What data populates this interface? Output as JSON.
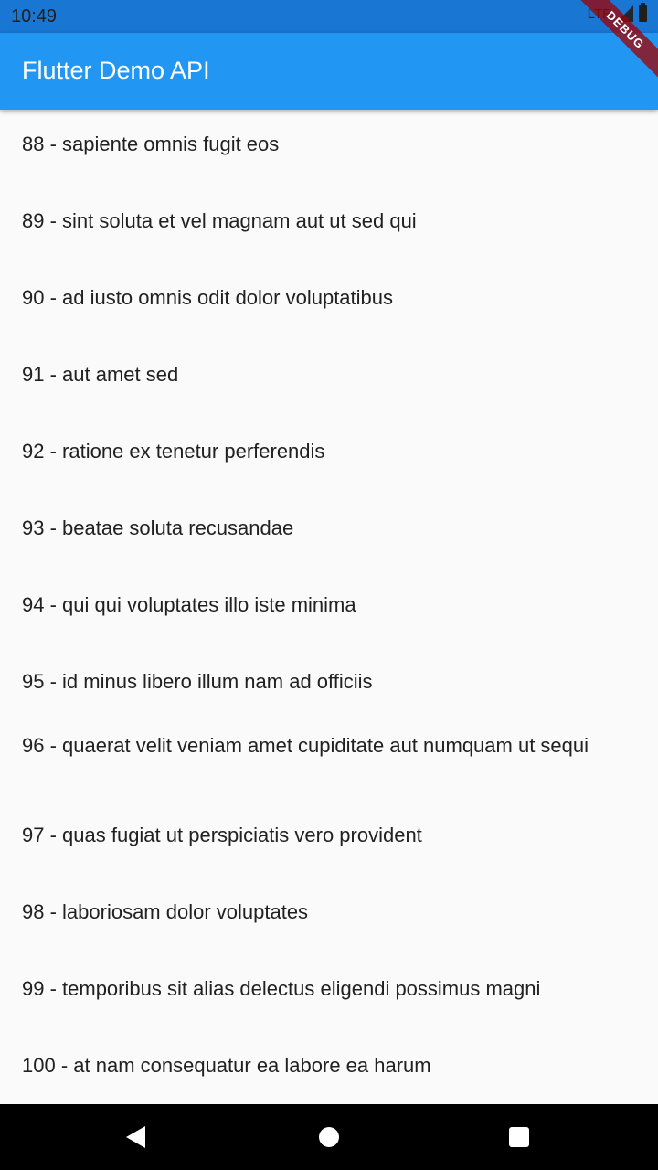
{
  "status_bar": {
    "time": "10:49",
    "network": "LTE"
  },
  "app_bar": {
    "title": "Flutter Demo API"
  },
  "debug_banner": {
    "label": "DEBUG"
  },
  "list": {
    "items": [
      "88 - sapiente omnis fugit eos",
      "89 - sint soluta et vel magnam aut ut sed qui",
      "90 - ad iusto omnis odit dolor voluptatibus",
      "91 - aut amet sed",
      "92 - ratione ex tenetur perferendis",
      "93 - beatae soluta recusandae",
      "94 - qui qui voluptates illo iste minima",
      "95 - id minus libero illum nam ad officiis",
      "96 - quaerat velit veniam amet cupiditate aut numquam ut sequi",
      "97 - quas fugiat ut perspiciatis vero provident",
      "98 - laboriosam dolor voluptates",
      "99 - temporibus sit alias delectus eligendi possimus magni",
      "100 - at nam consequatur ea labore ea harum"
    ]
  },
  "nav_bar": {
    "icons": [
      "back-icon",
      "home-icon",
      "recents-icon"
    ]
  },
  "colors": {
    "status_bar": "#1976d2",
    "app_bar": "#2196f3",
    "background": "#fafafa",
    "nav_bar": "#000000"
  }
}
